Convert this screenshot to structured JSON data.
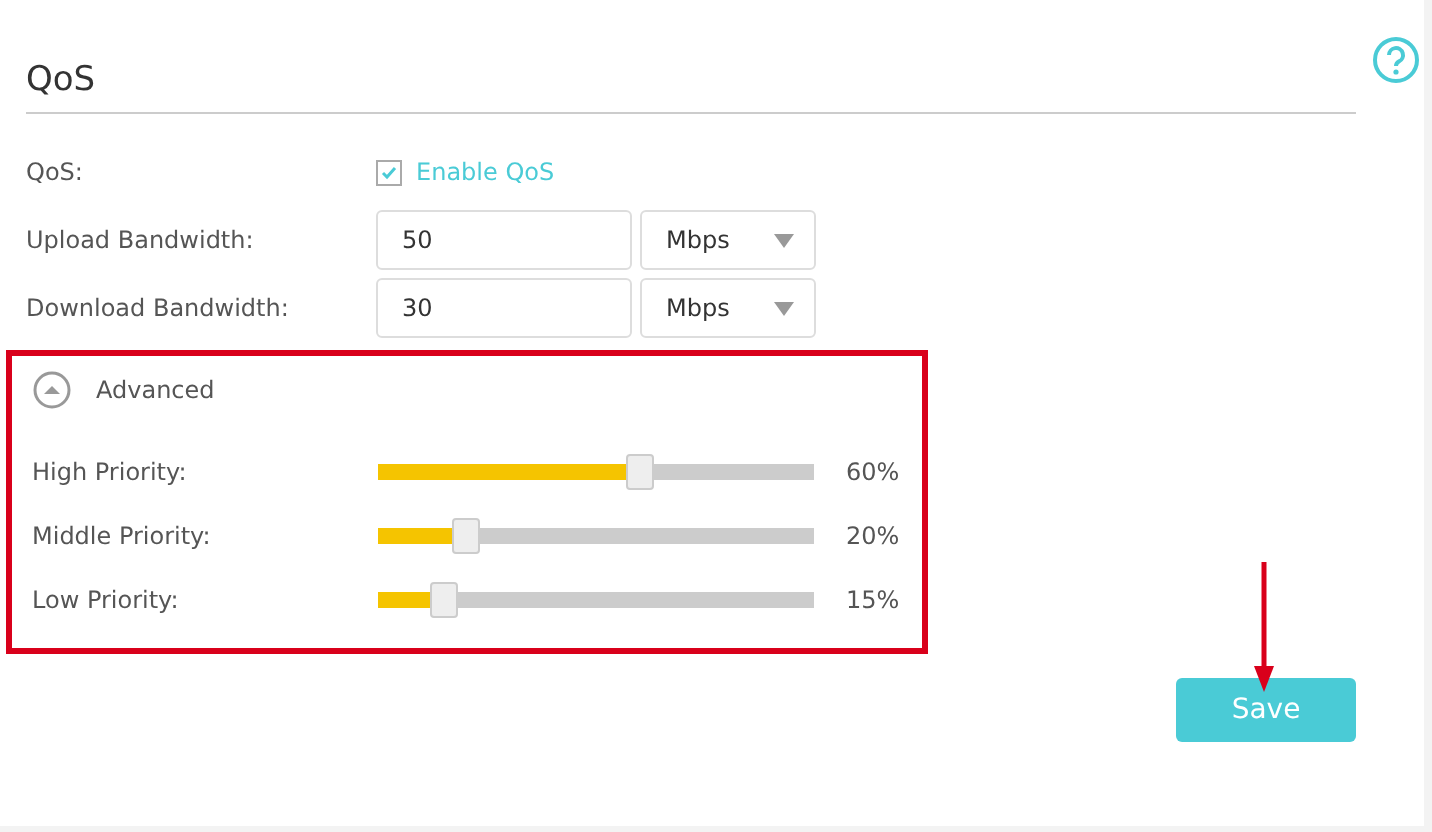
{
  "title": "QoS",
  "qos": {
    "label": "QoS:",
    "checkbox_label": "Enable QoS",
    "checked": true
  },
  "bandwidth": [
    {
      "label": "Upload Bandwidth:",
      "value": "50",
      "unit": "Mbps"
    },
    {
      "label": "Download Bandwidth:",
      "value": "30",
      "unit": "Mbps"
    }
  ],
  "advanced": {
    "label": "Advanced",
    "expanded": true,
    "highlighted": true,
    "priorities": [
      {
        "label": "High Priority:",
        "level": 0.6,
        "reading": "60%"
      },
      {
        "label": "Middle Priority:",
        "level": 0.2,
        "reading": "20%"
      },
      {
        "label": "Low Priority:",
        "level": 0.15,
        "reading": "15%"
      }
    ]
  },
  "save_button": "Save",
  "annotations": [
    {
      "kind": "arrow"
    }
  ]
}
